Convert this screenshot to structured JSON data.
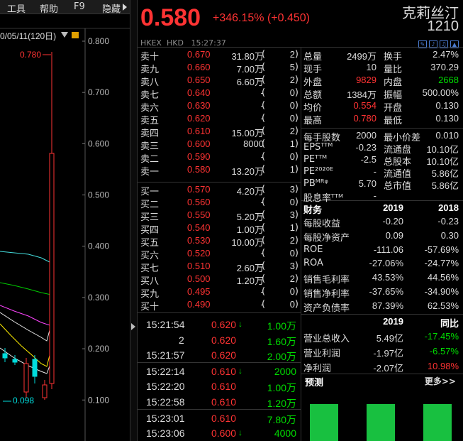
{
  "menu": {
    "items": [
      "工具",
      "帮助",
      "F9",
      "隐藏"
    ]
  },
  "chart": {
    "date_label": "0/05/11(120日)",
    "y_ticks": [
      "0.800",
      "0.700",
      "0.600",
      "0.500",
      "0.400",
      "0.300",
      "0.200",
      "0.100"
    ],
    "high_label": "0.780",
    "low_label": "0.098",
    "colors": {
      "ma1": "#e8e8e8",
      "ma2": "#ffee00",
      "ma3": "#ff44ff",
      "ma4": "#00cc00",
      "ma5": "#44dddd",
      "up": "#ff3333",
      "down": "#00dddd"
    }
  },
  "quote": {
    "price": "0.580",
    "change": "+346.15% (+0.450)",
    "name": "克莉丝汀",
    "code": "1210",
    "exchange": "HKEX",
    "currency": "HKD",
    "time": "15:27:37"
  },
  "order_book": {
    "asks": [
      {
        "label": "卖十",
        "price": "0.670",
        "volume": "31.80万",
        "count": "2"
      },
      {
        "label": "卖九",
        "price": "0.660",
        "volume": "7.00万",
        "count": "5"
      },
      {
        "label": "卖八",
        "price": "0.650",
        "volume": "6.60万",
        "count": "2"
      },
      {
        "label": "卖七",
        "price": "0.640",
        "volume": "-",
        "count": "0"
      },
      {
        "label": "卖六",
        "price": "0.630",
        "volume": "-",
        "count": "0"
      },
      {
        "label": "卖五",
        "price": "0.620",
        "volume": "-",
        "count": "0"
      },
      {
        "label": "卖四",
        "price": "0.610",
        "volume": "15.00万",
        "count": "2"
      },
      {
        "label": "卖三",
        "price": "0.600",
        "volume": "8000",
        "count": "1"
      },
      {
        "label": "卖二",
        "price": "0.590",
        "volume": "-",
        "count": "0"
      },
      {
        "label": "卖一",
        "price": "0.580",
        "volume": "13.20万",
        "count": "1"
      }
    ],
    "bids": [
      {
        "label": "买一",
        "price": "0.570",
        "volume": "4.20万",
        "count": "3"
      },
      {
        "label": "买二",
        "price": "0.560",
        "volume": "-",
        "count": "0"
      },
      {
        "label": "买三",
        "price": "0.550",
        "volume": "5.20万",
        "count": "3"
      },
      {
        "label": "买四",
        "price": "0.540",
        "volume": "1.00万",
        "count": "1"
      },
      {
        "label": "买五",
        "price": "0.530",
        "volume": "10.00万",
        "count": "2"
      },
      {
        "label": "买六",
        "price": "0.520",
        "volume": "-",
        "count": "0"
      },
      {
        "label": "买七",
        "price": "0.510",
        "volume": "2.60万",
        "count": "3"
      },
      {
        "label": "买八",
        "price": "0.500",
        "volume": "1.20万",
        "count": "2"
      },
      {
        "label": "买九",
        "price": "0.495",
        "volume": "-",
        "count": "0"
      },
      {
        "label": "买十",
        "price": "0.490",
        "volume": "-",
        "count": "0"
      }
    ]
  },
  "stats": [
    {
      "l1": "总量",
      "v1": "2499万",
      "l2": "换手",
      "v2": "2.47%",
      "c1": "",
      "c2": ""
    },
    {
      "l1": "现手",
      "v1": "10",
      "l2": "量比",
      "v2": "370.29",
      "c1": "",
      "c2": ""
    },
    {
      "l1": "外盘",
      "v1": "9829",
      "l2": "内盘",
      "v2": "2668",
      "c1": "red",
      "c2": "green"
    },
    {
      "l1": "总额",
      "v1": "1384万",
      "l2": "振幅",
      "v2": "500.00%",
      "c1": "",
      "c2": ""
    },
    {
      "l1": "均价",
      "v1": "0.554",
      "l2": "开盘",
      "v2": "0.130",
      "c1": "red",
      "c2": ""
    },
    {
      "l1": "最高",
      "v1": "0.780",
      "l2": "最低",
      "v2": "0.130",
      "c1": "red",
      "c2": ""
    },
    {
      "l1": "每手股数",
      "v1": "2000",
      "l2": "最小价差",
      "v2": "0.010",
      "c1": "",
      "c2": ""
    },
    {
      "l1": "EPSᵀᵀᴹ",
      "v1": "-0.23",
      "l2": "流通盘",
      "v2": "10.10亿",
      "c1": "",
      "c2": ""
    },
    {
      "l1": "PEᵀᵀᴹ",
      "v1": "-2.5",
      "l2": "总股本",
      "v2": "10.10亿",
      "c1": "",
      "c2": ""
    },
    {
      "l1": "PE²⁰²⁰ᴱ",
      "v1": "-",
      "l2": "流通值",
      "v2": "5.86亿",
      "c1": "",
      "c2": ""
    },
    {
      "l1": "PBᴹᴿᵠ",
      "v1": "5.70",
      "l2": "总市值",
      "v2": "5.86亿",
      "c1": "",
      "c2": ""
    },
    {
      "l1": "股息率ᵀᵀᴹ",
      "v1": "-",
      "l2": "",
      "v2": "",
      "c1": "",
      "c2": ""
    }
  ],
  "finance": {
    "header": {
      "label": "财务",
      "y1": "2019",
      "y2": "2018"
    },
    "rows": [
      {
        "label": "每股收益",
        "v1": "-0.20",
        "v2": "-0.23"
      },
      {
        "label": "每股净资产",
        "v1": "0.09",
        "v2": "0.30"
      },
      {
        "label": "ROE",
        "v1": "-111.06",
        "v2": "-57.69%"
      },
      {
        "label": "ROA",
        "v1": "-27.06%",
        "v2": "-24.77%"
      },
      {
        "label": "销售毛利率",
        "v1": "43.53%",
        "v2": "44.56%"
      },
      {
        "label": "销售净利率",
        "v1": "-37.65%",
        "v2": "-34.90%"
      },
      {
        "label": "资产负债率",
        "v1": "87.39%",
        "v2": "62.53%"
      }
    ],
    "header2": {
      "y1": "2019",
      "y2": "同比"
    },
    "rows2": [
      {
        "label": "营业总收入",
        "v1": "5.49亿",
        "v2": "-17.45%",
        "c2": "green"
      },
      {
        "label": "营业利润",
        "v1": "-1.97亿",
        "v2": "-6.57%",
        "c2": "green"
      },
      {
        "label": "净利润",
        "v1": "-2.07亿",
        "v2": "10.98%",
        "c2": "red"
      }
    ],
    "forecast_title": "预测",
    "more_label": "更多>>"
  },
  "ticks": [
    {
      "time": "15:21:54",
      "price": "0.620",
      "arrow": "↓",
      "volume": "1.00万"
    },
    {
      "time": "2",
      "price": "0.620",
      "arrow": "",
      "volume": "1.60万"
    },
    {
      "time": "15:21:57",
      "price": "0.620",
      "arrow": "",
      "volume": "2.00万"
    },
    {
      "time": "15:22:14",
      "price": "0.610",
      "arrow": "↓",
      "volume": "2000"
    },
    {
      "time": "15:22:20",
      "price": "0.610",
      "arrow": "",
      "volume": "1.00万"
    },
    {
      "time": "15:22:58",
      "price": "0.610",
      "arrow": "",
      "volume": "1.20万"
    },
    {
      "time": "15:23:01",
      "price": "0.610",
      "arrow": "",
      "volume": "7.80万"
    },
    {
      "time": "15:23:06",
      "price": "0.600",
      "arrow": "↓",
      "volume": "4000"
    }
  ]
}
